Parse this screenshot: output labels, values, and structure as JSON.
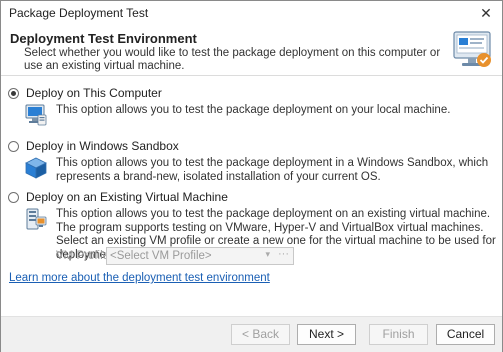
{
  "window": {
    "title": "Package Deployment Test",
    "close_glyph": "✕"
  },
  "header": {
    "title": "Deployment Test Environment",
    "subtitle": "Select whether you would like to test the package deployment on this computer or use an existing virtual machine."
  },
  "options": [
    {
      "label": "Deploy on This Computer",
      "description": "This option allows you to test the package deployment on your local machine.",
      "selected": true,
      "icon": "computer-icon"
    },
    {
      "label": "Deploy in Windows Sandbox",
      "description": "This option allows you to test the package deployment in a Windows Sandbox, which represents a brand-new, isolated installation of your current OS.",
      "selected": false,
      "icon": "sandbox-icon"
    },
    {
      "label": "Deploy on an Existing Virtual Machine",
      "description": "This option allows you to test the package deployment on an existing virtual machine. The program supports testing on VMware, Hyper-V and VirtualBox virtual machines. Select an existing VM profile or create a new one for the virtual machine to be used for deployment testing.",
      "selected": false,
      "icon": "server-icon"
    }
  ],
  "vm_profile": {
    "label": "VM Profile:",
    "placeholder": "<Select VM Profile>",
    "arrow": "▾",
    "dots": "···"
  },
  "learn_more": "Learn more about the deployment test environment",
  "buttons": {
    "back": "< Back",
    "next": "Next >",
    "finish": "Finish",
    "cancel": "Cancel"
  },
  "colors": {
    "link": "#1a5fb4",
    "footer_bg": "#f0f0f0",
    "accent": "#2a7fd4"
  }
}
